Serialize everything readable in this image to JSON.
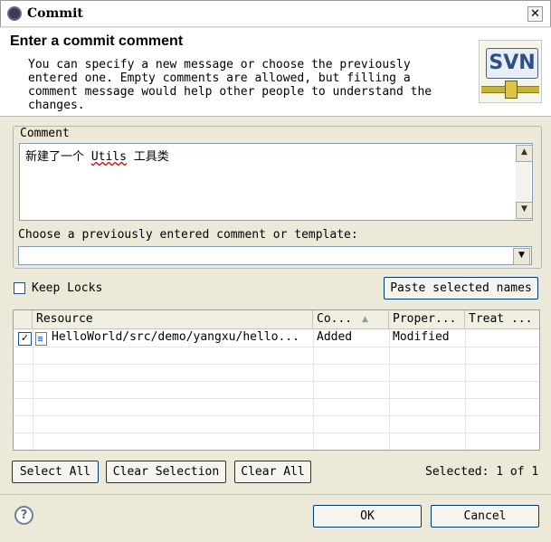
{
  "window": {
    "title": "Commit",
    "close_glyph": "✕"
  },
  "header": {
    "heading": "Enter a commit comment",
    "description": "You can specify a new message or choose the previously\nentered one. Empty comments are allowed, but filling a\ncomment message would help other people to understand the\nchanges.",
    "logo_text": "SVN"
  },
  "comment": {
    "group_label": "Comment",
    "text_before": "新建了一个 ",
    "text_underlined": "Utils",
    "text_after": " 工具类",
    "template_label": "Choose a previously entered comment or template:",
    "template_value": ""
  },
  "keep_locks": {
    "label": "Keep Locks",
    "checked": false
  },
  "paste_button": "Paste selected names",
  "table": {
    "headers": [
      "Resource",
      "Co...",
      "Proper...",
      "Treat ..."
    ],
    "sort_indicator": "▲",
    "rows": [
      {
        "checked": true,
        "resource": "HelloWorld/src/demo/yangxu/hello...",
        "content": "Added",
        "properties": "Modified",
        "treat": ""
      }
    ]
  },
  "buttons": {
    "select_all": "Select All",
    "clear_selection": "Clear Selection",
    "clear_all": "Clear All",
    "ok": "OK",
    "cancel": "Cancel"
  },
  "selection_status": "Selected: 1 of 1",
  "icons": {
    "app": "gear-icon",
    "help": "help-icon",
    "file": "java-file-icon"
  },
  "colors": {
    "dialog_bg": "#ece9d8",
    "field_border": "#7f9db9",
    "button_border": "#003c74"
  }
}
